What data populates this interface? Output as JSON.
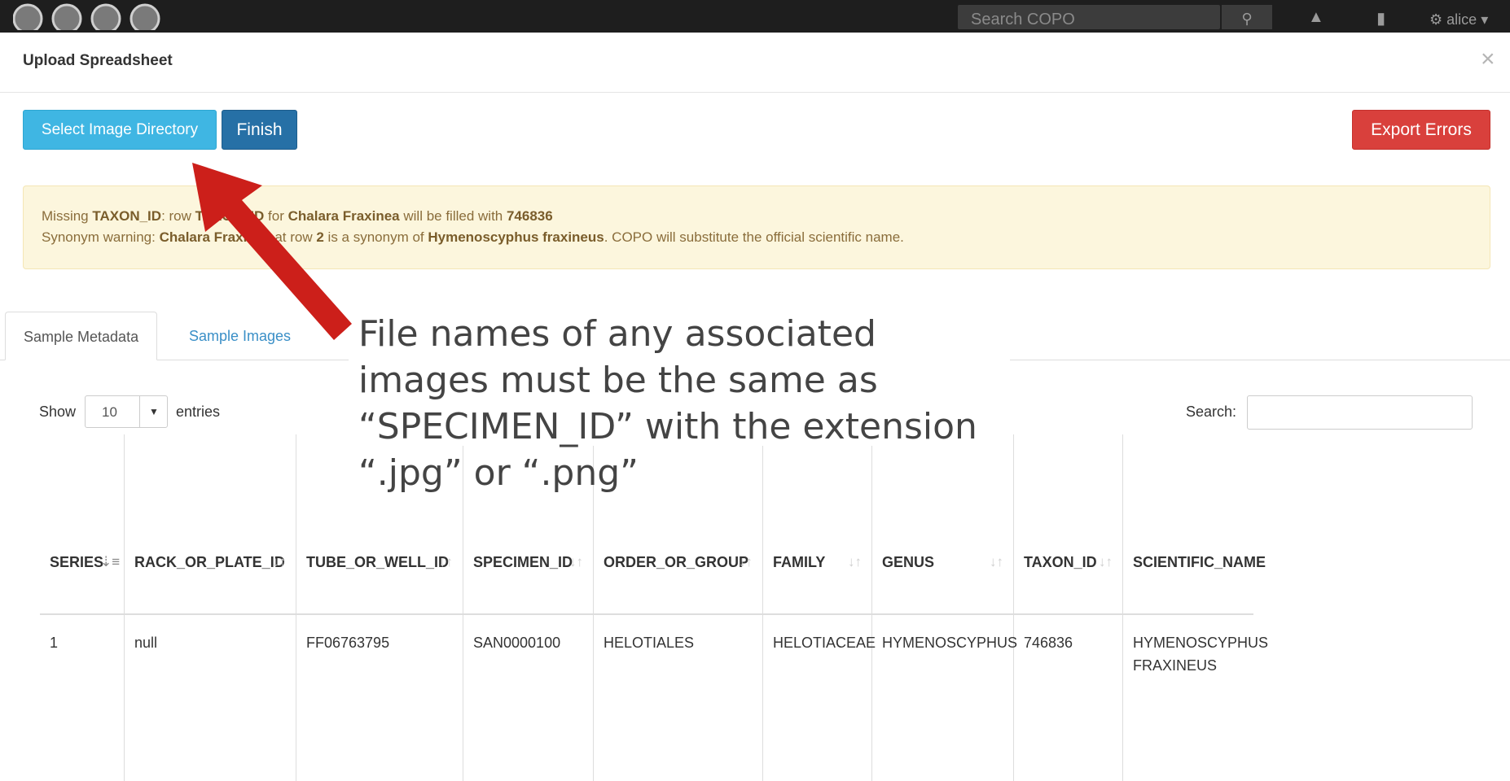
{
  "navbar": {
    "search_placeholder": "Search COPO",
    "user": "alice"
  },
  "modal": {
    "title": "Upload Spreadsheet",
    "close": "×",
    "select_dir_label": "Select Image Directory",
    "finish_label": "Finish",
    "export_label": "Export Errors"
  },
  "alert": {
    "line1": [
      {
        "t": "Missing ",
        "b": false
      },
      {
        "t": "TAXON_ID",
        "b": true
      },
      {
        "t": ": row ",
        "b": false
      },
      {
        "t": "TAXON_ID",
        "b": true
      },
      {
        "t": " for ",
        "b": false
      },
      {
        "t": "Chalara Fraxinea",
        "b": true
      },
      {
        "t": " will be filled with ",
        "b": false
      },
      {
        "t": "746836",
        "b": true
      }
    ],
    "line2": [
      {
        "t": "Synonym warning: ",
        "b": false
      },
      {
        "t": "Chalara Fraxinea",
        "b": true
      },
      {
        "t": " at row ",
        "b": false
      },
      {
        "t": "2",
        "b": true
      },
      {
        "t": " is a synonym of ",
        "b": false
      },
      {
        "t": "Hymenoscyphus fraxineus",
        "b": true
      },
      {
        "t": ". COPO will substitute the official scientific name.",
        "b": false
      }
    ]
  },
  "tabs": [
    {
      "label": "Sample Metadata"
    },
    {
      "label": "Sample Images"
    }
  ],
  "table_controls": {
    "show": "Show",
    "entries_value": "10",
    "entries": "entries",
    "search": "Search:"
  },
  "table": {
    "columns": [
      "SERIES",
      "RACK_OR_PLATE_ID",
      "TUBE_OR_WELL_ID",
      "SPECIMEN_ID",
      "ORDER_OR_GROUP",
      "FAMILY",
      "GENUS",
      "TAXON_ID",
      "SCIENTIFIC_NAME"
    ],
    "rows": [
      [
        "1",
        "null",
        "FF06763795",
        "SAN0000100",
        "HELOTIALES",
        "HELOTIACEAE",
        "HYMENOSCYPHUS",
        "746836",
        "HYMENOSCYPHUS\nFRAXINEUS"
      ]
    ]
  },
  "annotation": {
    "text": "File names of any associated images must be the same as “SPECIMEN_ID” with the extension “.jpg” or “.png”"
  },
  "colors": {
    "btn_info": "#3fb6e3",
    "btn_primary": "#2670a6",
    "btn_danger": "#d9403c",
    "alert_bg": "#fcf6dd",
    "arrow": "#cc1f1a"
  }
}
